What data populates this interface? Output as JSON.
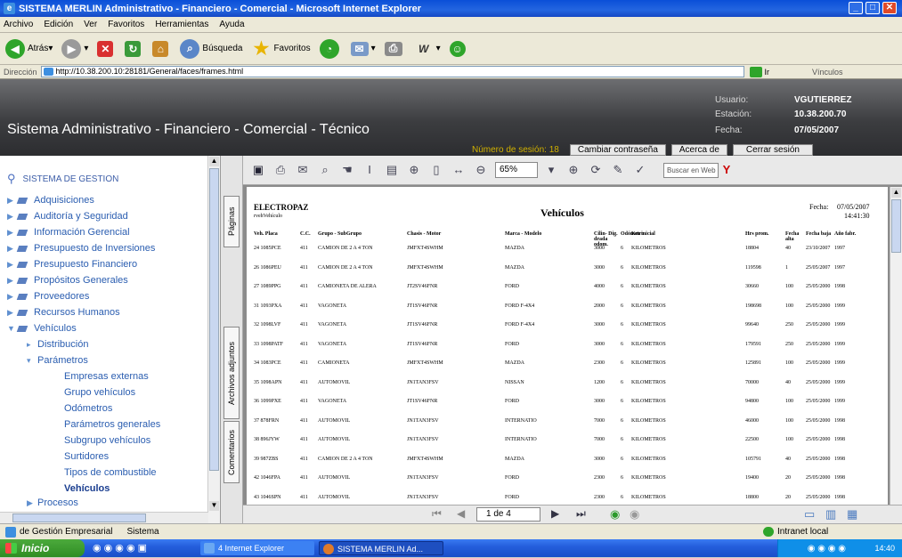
{
  "window": {
    "title": "SISTEMA MERLIN Administrativo - Financiero - Comercial - Microsoft Internet Explorer"
  },
  "menu": [
    "Archivo",
    "Edición",
    "Ver",
    "Favoritos",
    "Herramientas",
    "Ayuda"
  ],
  "toolbar": {
    "back": "Atrás",
    "search": "Búsqueda",
    "favorites": "Favoritos"
  },
  "address": {
    "label": "Dirección",
    "url": "http://10.38.200.10:28181/General/faces/frames.html",
    "go": "Ir",
    "links": "Vínculos"
  },
  "header": {
    "app_title": "Sistema Administrativo - Financiero - Comercial - Técnico",
    "user_label": "Usuario:",
    "user": "VGUTIERREZ",
    "station_label": "Estación:",
    "station": "10.38.200.70",
    "date_label": "Fecha:",
    "date": "07/05/2007",
    "session": "Número de sesión: 18",
    "btn_password": "Cambiar contraseña",
    "btn_about": "Acerca de",
    "btn_logout": "Cerrar sesión"
  },
  "sidebar": {
    "title": "SISTEMA DE GESTION",
    "items": [
      "Adquisiciones",
      "Auditoría y Seguridad",
      "Información Gerencial",
      "Presupuesto de Inversiones",
      "Presupuesto Financiero",
      "Propósitos Generales",
      "Proveedores",
      "Recursos Humanos",
      "Vehículos"
    ],
    "vehiculos_children": [
      "Distribución",
      "Parámetros"
    ],
    "parametros_children": [
      "Empresas externas",
      "Grupo vehículos",
      "Odómetros",
      "Parámetros generales",
      "Subgrupo vehículos",
      "Surtidores",
      "Tipos de combustible",
      "Vehículos"
    ],
    "last": "Procesos"
  },
  "tabs": [
    "Páginas",
    "Archivos adjuntos",
    "Comentarios"
  ],
  "viewer": {
    "zoom": "65%",
    "search_placeholder": "Buscar en Web",
    "page": "1 de 4"
  },
  "report": {
    "company": "ELECTROPAZ",
    "sub": "rvehVehículo",
    "title": "Vehículos",
    "date_label": "Fecha:",
    "date": "07/05/2007",
    "time": "14:41:30",
    "columns": [
      "Veh. Placa",
      "C.C.",
      "Grupo - SubGrupo",
      "Chasis - Motor",
      "Marca - Modelo",
      "Cilin- Dig. drada odom.",
      "Odómetro",
      "Km inicial",
      "Hrs prom.",
      "Fecha alta",
      "Fecha baja",
      "Año fabr."
    ],
    "rows": [
      [
        "24 1085PCE",
        "411",
        "CAMION DE 2 A 4 TON",
        "JMFXT4SWHM",
        "MAZDA",
        "3000",
        "6",
        "KILOMETROS",
        "18804",
        "40",
        "23/10/2007",
        "1997"
      ],
      [
        "26 1086PEU",
        "411",
        "CAMION DE 2 A 4 TON",
        "JMFXT4SWHM",
        "MAZDA",
        "3000",
        "6",
        "KILOMETROS",
        "119598",
        "1",
        "25/05/2007",
        "1997"
      ],
      [
        "27 1089PPG",
        "411",
        "CAMIONETA DE ALERA",
        "JT2SV46FNR",
        "FORD",
        "4000",
        "6",
        "KILOMETROS",
        "30660",
        "100",
        "25/05/2000",
        "1998"
      ],
      [
        "31 1093PXA",
        "411",
        "VAGONETA",
        "JT1SV46FNR",
        "FORD F-4X4",
        "2000",
        "6",
        "KILOMETROS",
        "198698",
        "100",
        "25/05/2000",
        "1999"
      ],
      [
        "32 1098LVF",
        "411",
        "VAGONETA",
        "JT1SV46FNR",
        "FORD F-4X4",
        "3000",
        "6",
        "KILOMETROS",
        "99640",
        "250",
        "25/05/2000",
        "1999"
      ],
      [
        "33 1098PATF",
        "411",
        "VAGONETA",
        "JT1SV46FNR",
        "FORD",
        "3000",
        "6",
        "KILOMETROS",
        "179591",
        "250",
        "25/05/2000",
        "1999"
      ],
      [
        "34 1083PCE",
        "411",
        "CAMIONETA",
        "JMFXT4SWHM",
        "MAZDA",
        "2300",
        "6",
        "KILOMETROS",
        "125891",
        "100",
        "25/05/2000",
        "1999"
      ],
      [
        "35 1098APN",
        "411",
        "AUTOMOVIL",
        "JN1TAN3FSV",
        "NISSAN",
        "1200",
        "6",
        "KILOMETROS",
        "70000",
        "40",
        "25/05/2000",
        "1999"
      ],
      [
        "36 1099PXE",
        "411",
        "VAGONETA",
        "JT1SV46FNR",
        "FORD",
        "3000",
        "6",
        "KILOMETROS",
        "94800",
        "100",
        "25/05/2000",
        "1999"
      ],
      [
        "37 878FRN",
        "411",
        "AUTOMOVIL",
        "JN1TAN3FSV",
        "INTERNATIO",
        "7000",
        "6",
        "KILOMETROS",
        "46000",
        "100",
        "25/05/2000",
        "1998"
      ],
      [
        "38 896JYW",
        "411",
        "AUTOMOVIL",
        "JN1TAN3FSV",
        "INTERNATIO",
        "7000",
        "6",
        "KILOMETROS",
        "22500",
        "100",
        "25/05/2000",
        "1998"
      ],
      [
        "39 987ZBS",
        "411",
        "CAMION DE 2 A 4 TON",
        "JMFXT4SWHM",
        "MAZDA",
        "3000",
        "6",
        "KILOMETROS",
        "105791",
        "40",
        "25/05/2000",
        "1998"
      ],
      [
        "42 1046FPA",
        "411",
        "AUTOMOVIL",
        "JN1TAN3FSV",
        "FORD",
        "2300",
        "6",
        "KILOMETROS",
        "19400",
        "20",
        "25/05/2000",
        "1998"
      ],
      [
        "43 1046SPN",
        "411",
        "AUTOMOVIL",
        "JN1TAN3FSV",
        "FORD",
        "2300",
        "6",
        "KILOMETROS",
        "18800",
        "20",
        "25/05/2000",
        "1998"
      ]
    ]
  },
  "status": {
    "left": "de Gestión Empresarial",
    "mid": "Sistema",
    "zone": "Intranet local"
  },
  "taskbar": {
    "start": "Inicio",
    "task1": "4 Internet Explorer",
    "task2": "SISTEMA MERLIN Ad...",
    "clock": "14:40"
  }
}
